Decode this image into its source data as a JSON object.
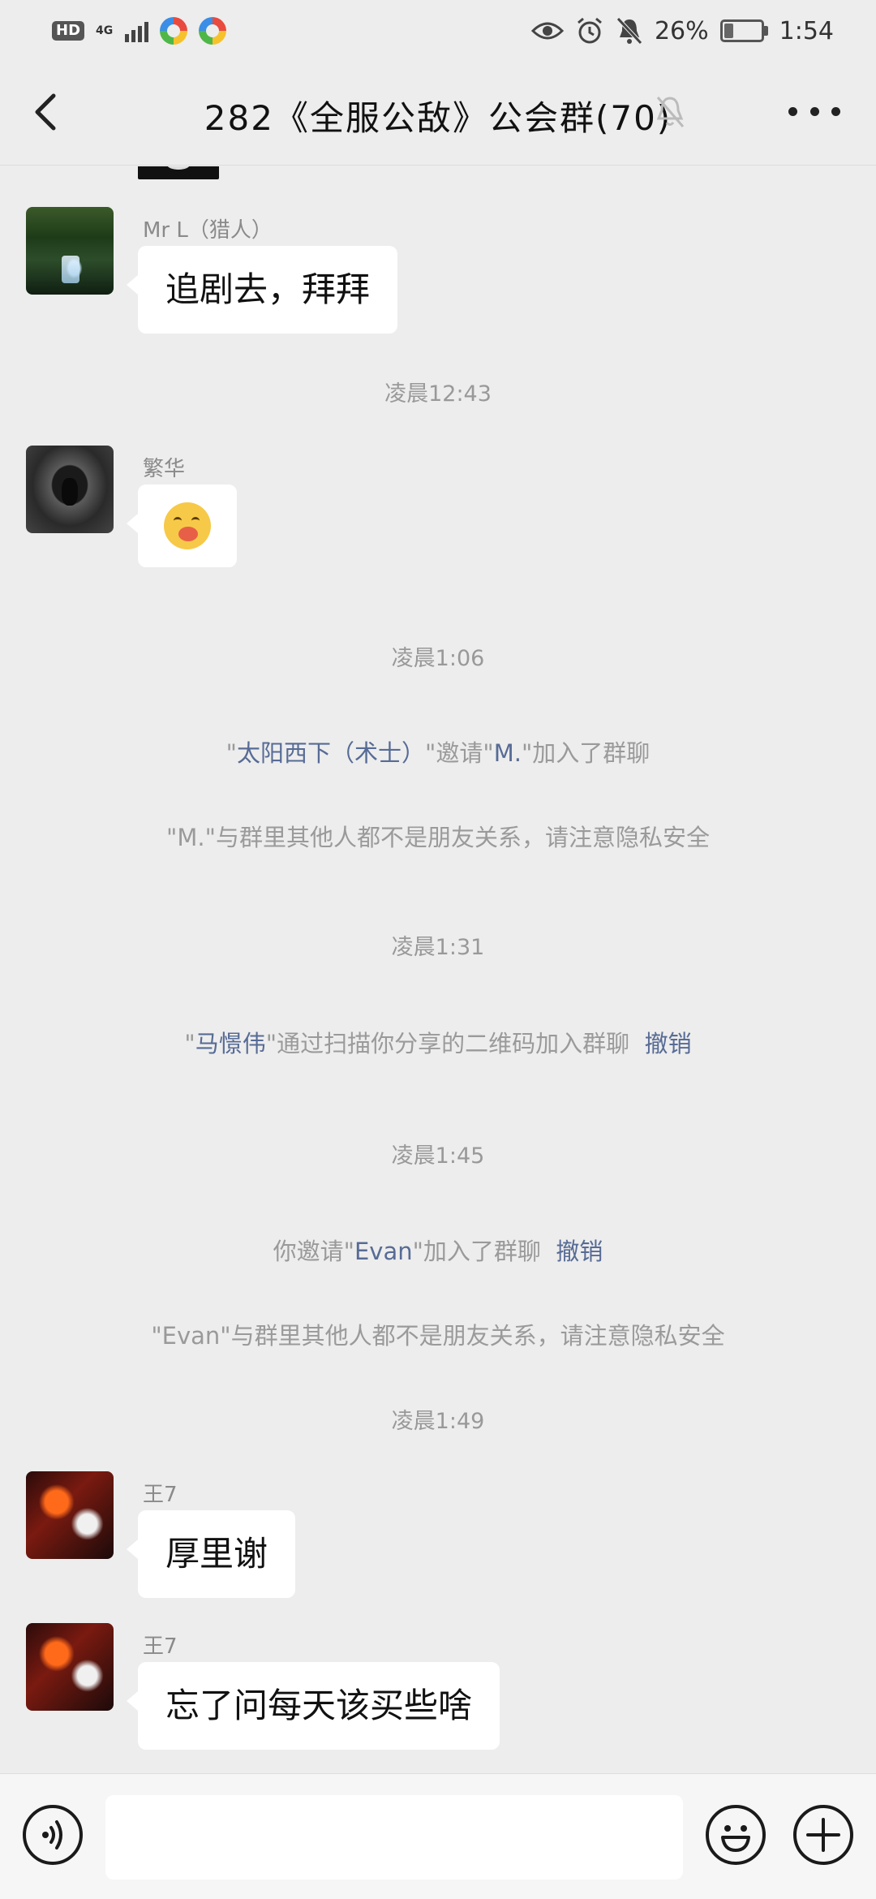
{
  "status_bar": {
    "hd": "HD",
    "network": "4G",
    "battery_percent": "26%",
    "battery_level": 0.26,
    "time": "1:54"
  },
  "header": {
    "title": "282《全服公敌》公会群(70)",
    "icons": [
      "back-icon",
      "mute-bell-icon",
      "more-icon"
    ]
  },
  "messages": [
    {
      "sender": "Mr L（猎人）",
      "text": "追剧去，拜拜",
      "avatar": "forest-waterfall"
    },
    {
      "time": "凌晨12:43"
    },
    {
      "sender": "繁华",
      "emoji": "blushing-face-emoji",
      "avatar": "hooded-figure"
    },
    {
      "time": "凌晨1:06"
    },
    {
      "system": {
        "quote_open": "\"",
        "actor": "太阳西下（术士）",
        "mid": "\"邀请\"",
        "target": "M.",
        "end": "\"加入了群聊"
      }
    },
    {
      "system_plain": "\"M.\"与群里其他人都不是朋友关系，请注意隐私安全"
    },
    {
      "time": "凌晨1:31"
    },
    {
      "system": {
        "quote_open": "\"",
        "actor": "马憬伟",
        "end": "\"通过扫描你分享的二维码加入群聊",
        "action": "撤销"
      }
    },
    {
      "time": "凌晨1:45"
    },
    {
      "system": {
        "prefix": "你邀请\"",
        "target": "Evan",
        "end": "\"加入了群聊",
        "action": "撤销"
      }
    },
    {
      "system_plain": "\"Evan\"与群里其他人都不是朋友关系，请注意隐私安全"
    },
    {
      "time": "凌晨1:49"
    },
    {
      "sender": "王7",
      "text": "厚里谢",
      "avatar": "red-fox"
    },
    {
      "sender": "王7",
      "text": "忘了问每天该买些啥",
      "avatar": "red-fox"
    }
  ],
  "input_bar": {
    "placeholder": "",
    "icons": [
      "voice-icon",
      "emoji-icon",
      "plus-icon"
    ]
  }
}
